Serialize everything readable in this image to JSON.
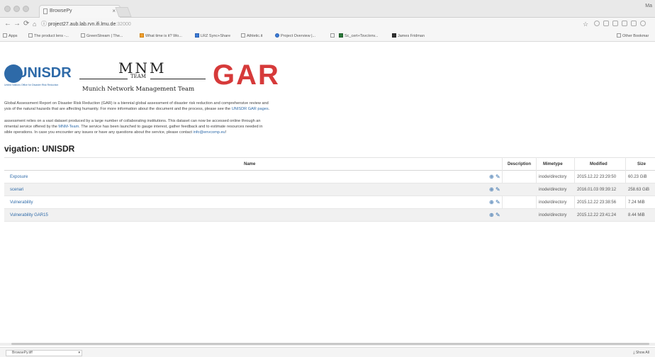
{
  "browser": {
    "tab_title": "BrowsePy",
    "tab_close": "×",
    "profile_name": "Ma",
    "url_main": "project27.aub.lab.rvn.ifi.lmu.de",
    "url_port": ":32000",
    "bookmarks": [
      "Apps",
      "The product lens -...",
      "GreenStream | The...",
      "What time is it? Wo...",
      "LRZ Sync+Share",
      "Athletic.it",
      "Project Overview |...",
      "",
      "Sc_cert+Tsvc/env...",
      "James Fridman"
    ],
    "other_bookmarks": "Other Bookmar"
  },
  "logos": {
    "unisdr": "UNISDR",
    "unisdr_sub": "United Nations Office for Disaster Risk Reduction",
    "mnm_big": "MNM",
    "mnm_team": "TEAM",
    "mnm_full": "Munich Network Management Team",
    "gar": "GAR"
  },
  "intro": {
    "p1_line1": "Global Assessment Report on Disaster Risk Reduction (GAR) is a biennial global assessment of disaster risk reduction and comprehensive review and",
    "p1_line2": "ysis of the natural hazards that are affecting humanity. For more information about the document and the process, please see the",
    "p1_link": "UNISDR GAR pages",
    "p1_end": ".",
    "p2_line1": "assessment relies on a vast dataset produced by a large number of collaborating institutions. This dataset can now be accessed online through an",
    "p2_line2_a": "rimental service offered by the",
    "p2_line2_link": "MNM-Team",
    "p2_line2_b": ". The service has been launched to gauge interest, gather feedback and to estimate resources needed in",
    "p2_line3_a": "sible operations. In case you encounter any issues or have any questions about the service, please contact",
    "p2_line3_link": "info@envcomp.eu",
    "p2_line3_b": "!"
  },
  "navigation_heading": "vigation: UNISDR",
  "table": {
    "headers": {
      "name": "Name",
      "description": "Description",
      "mimetype": "Mimetype",
      "modified": "Modified",
      "size": "Size"
    },
    "rows": [
      {
        "name": "Exposure",
        "mime": "inode/directory",
        "modified": "2015.12.22 23:29:50",
        "size": "60.23 GiB"
      },
      {
        "name": "scenari",
        "mime": "inode/directory",
        "modified": "2016.01.03 09:39:12",
        "size": "258.63 GiB"
      },
      {
        "name": "Vulnerability",
        "mime": "inode/directory",
        "modified": "2015.12.22 23:38:56",
        "size": "7.24 MiB"
      },
      {
        "name": "Vulnerability GAR15",
        "mime": "inode/directory",
        "modified": "2015.12.22 23:41:24",
        "size": "8.44 MiB"
      }
    ]
  },
  "downloads": {
    "item": "BrowsePy.tiff",
    "show_all": "Show All"
  },
  "colors": {
    "link": "#2e6aa8",
    "gar_red": "#d63a3a"
  }
}
